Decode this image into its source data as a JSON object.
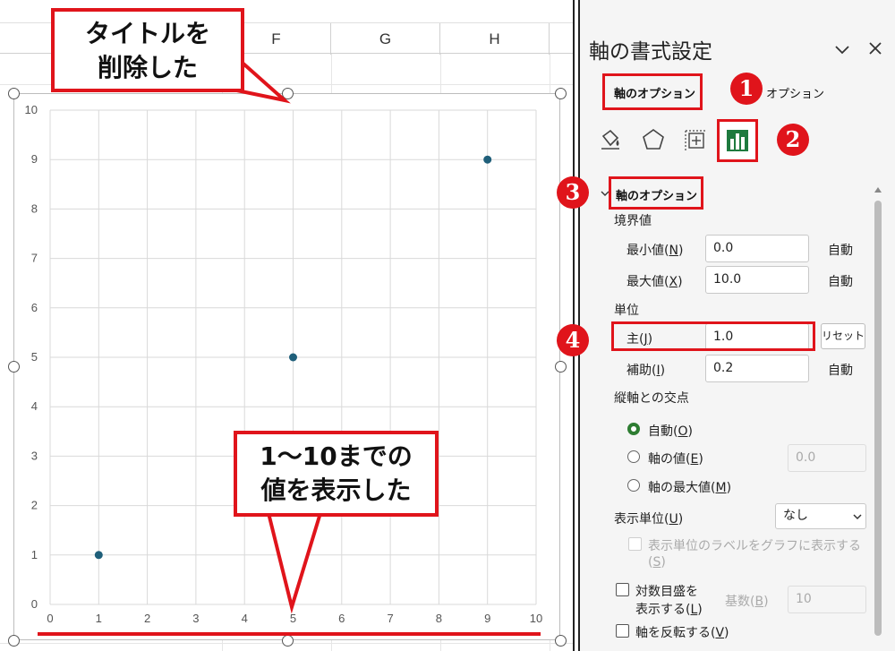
{
  "sheet": {
    "columns": [
      "",
      "F",
      "G",
      "H"
    ],
    "callouts": {
      "title_removed_line1": "タイトルを",
      "title_removed_line2": "削除した",
      "range_line1": "1～10までの",
      "range_line2": "値を表示した"
    }
  },
  "chart_data": {
    "type": "scatter",
    "title": "",
    "xlabel": "",
    "ylabel": "",
    "xlim": [
      0,
      10
    ],
    "ylim": [
      0,
      10
    ],
    "x_ticks": [
      "0",
      "1",
      "2",
      "3",
      "4",
      "5",
      "6",
      "7",
      "8",
      "9",
      "10"
    ],
    "y_ticks": [
      "0",
      "1",
      "2",
      "3",
      "4",
      "5",
      "6",
      "7",
      "8",
      "9",
      "10"
    ],
    "grid": true,
    "series": [
      {
        "points": [
          [
            1,
            1
          ],
          [
            5,
            5
          ],
          [
            9,
            9
          ]
        ],
        "color": "#1f5f7a"
      }
    ]
  },
  "pane": {
    "title": "軸の書式設定",
    "tabs": {
      "axis_options": "軸のオプション",
      "text_options": "オプション"
    },
    "icons": [
      "fill-line-icon",
      "effects-icon",
      "size-properties-icon",
      "axis-options-icon"
    ],
    "section_title": "軸のオプション",
    "bounds": {
      "heading": "境界値",
      "min": {
        "label": "最小値(",
        "key": "N",
        "close": ")",
        "value": "0.0",
        "auto": "自動"
      },
      "max": {
        "label": "最大値(",
        "key": "X",
        "close": ")",
        "value": "10.0",
        "auto": "自動"
      }
    },
    "units": {
      "heading": "単位",
      "major": {
        "label": "主(",
        "key": "J",
        "close": ")",
        "value": "1.0",
        "button": "リセット"
      },
      "minor": {
        "label": "補助(",
        "key": "I",
        "close": ")",
        "value": "0.2",
        "auto": "自動"
      }
    },
    "crosses": {
      "heading": "縦軸との交点",
      "auto": {
        "label": "自動(",
        "key": "O",
        "close": ")"
      },
      "value": {
        "label": "軸の値(",
        "key": "E",
        "close": ")",
        "input": "0.0"
      },
      "max": {
        "label": "軸の最大値(",
        "key": "M",
        "close": ")"
      }
    },
    "display_units": {
      "label": "表示単位(",
      "key": "U",
      "close": ")",
      "selected": "なし",
      "show_label_line1": "表示単位のラベルをグラフに表示する",
      "show_label_line2_pre": "(",
      "show_label_key": "S",
      "show_label_line2_post": ")"
    },
    "log_scale": {
      "line1": "対数目盛を",
      "line2_pre": "表示する(",
      "key": "L",
      "line2_post": ")",
      "base_label_pre": "基数(",
      "base_key": "B",
      "base_label_post": ")",
      "base_value": "10"
    },
    "reverse": {
      "label": "軸を反転する(",
      "key": "V",
      "close": ")"
    },
    "badges": [
      "1",
      "2",
      "3",
      "4"
    ]
  },
  "colors": {
    "accent_red": "#e0141b",
    "marker": "#1f5f7a",
    "active_icon": "#1e7a3e",
    "radio_checked": "#2e7d32"
  }
}
